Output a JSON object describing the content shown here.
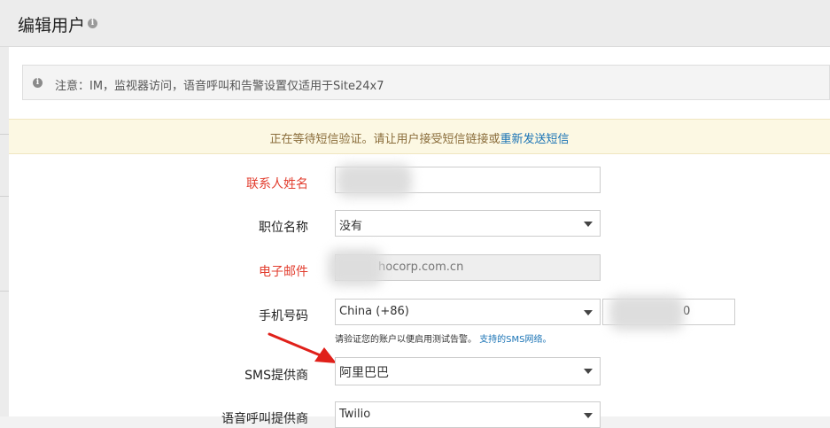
{
  "header": {
    "title": "编辑用户",
    "info_icon": "i"
  },
  "note": {
    "icon": "i",
    "text": "注意：IM，监视器访问，语音呼叫和告警设置仅适用于Site24x7"
  },
  "sms_banner": {
    "text": "正在等待短信验证。请让用户接受短信链接或",
    "link": "重新发送短信"
  },
  "form": {
    "contact_name": {
      "label": "联系人姓名",
      "value": ""
    },
    "job_title": {
      "label": "职位名称",
      "value": "没有"
    },
    "email": {
      "label": "电子邮件",
      "value": "hocorp.com.cn"
    },
    "phone": {
      "label": "手机号码",
      "country": "China (+86)",
      "number": "0",
      "hint": "请验证您的账户以便启用测试告警。",
      "hint_link": "支持的SMS网络。"
    },
    "sms_provider": {
      "label": "SMS提供商",
      "value": "阿里巴巴"
    },
    "voice_provider": {
      "label": "语音呼叫提供商",
      "value": "Twilio"
    }
  },
  "colors": {
    "required": "#e23d2e",
    "link": "#1a73b5",
    "banner_bg": "#fcf8e3",
    "arrow": "#e0201a"
  }
}
